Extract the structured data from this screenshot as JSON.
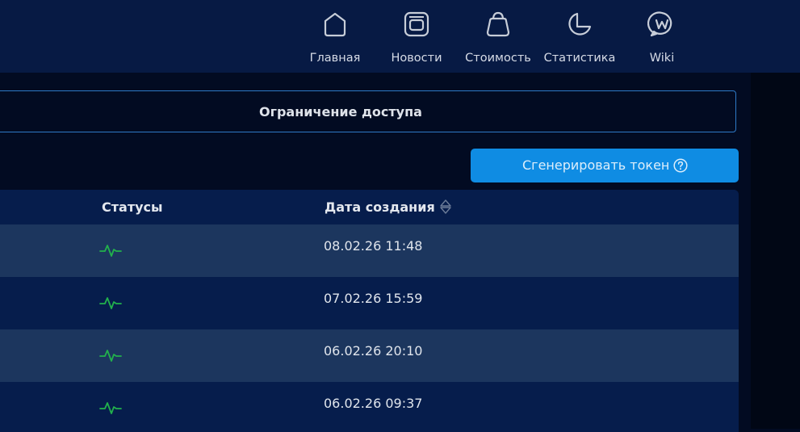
{
  "nav": {
    "items": [
      {
        "label": "Главная",
        "icon": "home-icon"
      },
      {
        "label": "Новости",
        "icon": "news-icon"
      },
      {
        "label": "Стоимость",
        "icon": "pricing-bag-icon"
      },
      {
        "label": "Статистика",
        "icon": "pie-chart-icon"
      },
      {
        "label": "Wiki",
        "icon": "wiki-icon"
      }
    ]
  },
  "access": {
    "title": "Ограничение доступа"
  },
  "actions": {
    "generate_label": "Сгенерировать токен",
    "generate_help_icon": "help-circle-icon"
  },
  "table": {
    "headers": {
      "status": "Статусы",
      "created": "Дата создания"
    },
    "rows": [
      {
        "status_icon": "activity-pulse-icon",
        "created": "08.02.26 11:48"
      },
      {
        "status_icon": "activity-pulse-icon",
        "created": "07.02.26 15:59"
      },
      {
        "status_icon": "activity-pulse-icon",
        "created": "06.02.26 20:10"
      },
      {
        "status_icon": "activity-pulse-icon",
        "created": "06.02.26 09:37"
      }
    ]
  },
  "colors": {
    "header_bg": "#071a44",
    "page_bg": "#020b22",
    "accent": "#0f8ce3",
    "status_ok": "#22b14c"
  }
}
